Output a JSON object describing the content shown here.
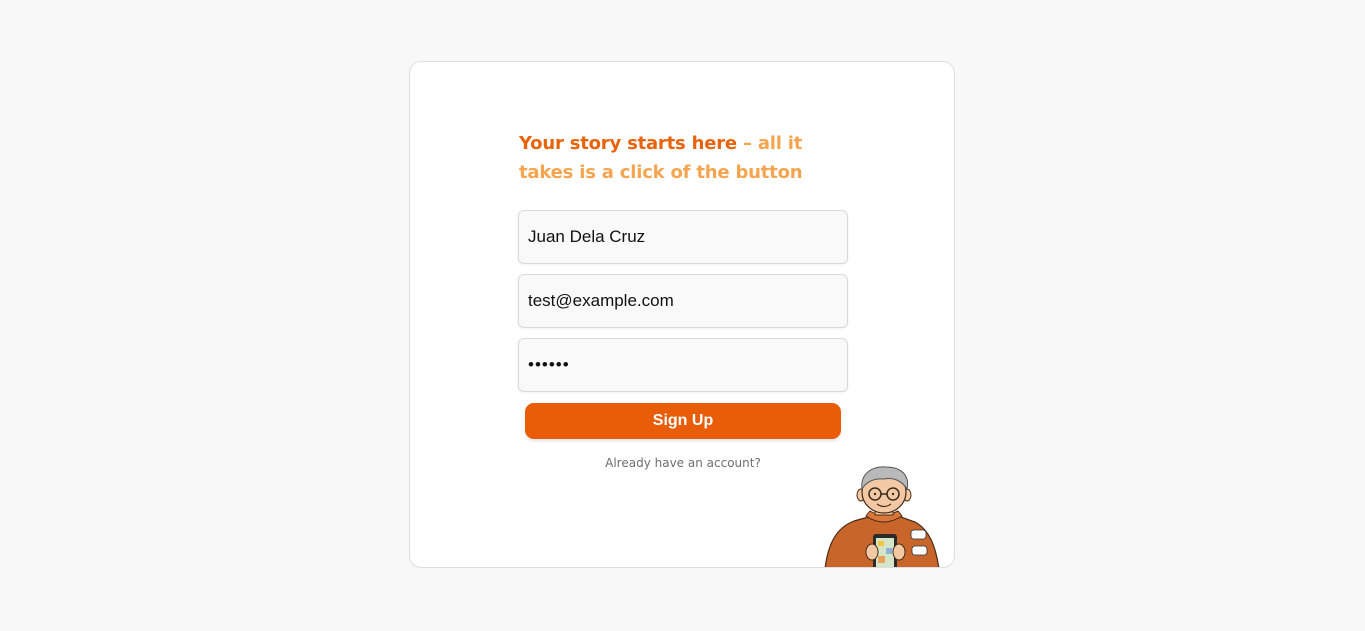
{
  "signup": {
    "headline_strong": "Your story starts here",
    "headline_soft": " – all it takes is a click of the button",
    "name_value": "Juan Dela Cruz",
    "email_value": "test@example.com",
    "password_value": "123456",
    "submit_label": "Sign Up",
    "login_prompt": "Already have an account?"
  },
  "colors": {
    "accent": "#e95c08",
    "headline_strong": "#e8640c",
    "headline_soft": "#f5a54f",
    "page_background": "#f8f8f8"
  },
  "icons": {
    "illustration": "grandpa-with-phone-illustration"
  }
}
